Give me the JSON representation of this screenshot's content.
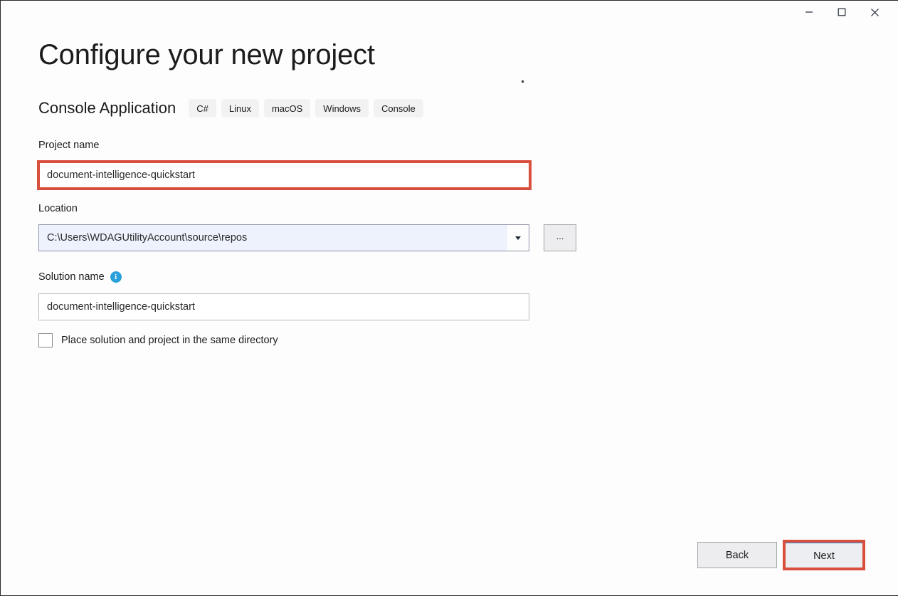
{
  "window": {
    "controls": {
      "minimize": "minimize-button",
      "maximize": "maximize-button",
      "close": "close-button"
    }
  },
  "header": {
    "title": "Configure your new project",
    "template_name": "Console Application",
    "tags": [
      "C#",
      "Linux",
      "macOS",
      "Windows",
      "Console"
    ]
  },
  "form": {
    "project_name": {
      "label": "Project name",
      "value": "document-intelligence-quickstart"
    },
    "location": {
      "label": "Location",
      "value": "C:\\Users\\WDAGUtilityAccount\\source\\repos",
      "browse_label": "..."
    },
    "solution_name": {
      "label": "Solution name",
      "info_icon": "i",
      "value": "document-intelligence-quickstart"
    },
    "same_directory": {
      "label": "Place solution and project in the same directory",
      "checked": false
    }
  },
  "footer": {
    "back_label": "Back",
    "next_label": "Next"
  },
  "colors": {
    "annotation": "#d94f3d",
    "accent": "#2b88d8",
    "info": "#29A0DA"
  }
}
